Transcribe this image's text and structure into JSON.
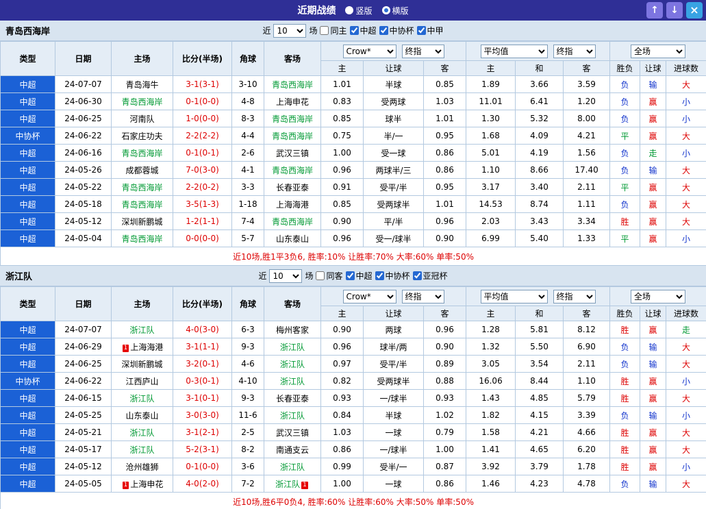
{
  "titlebar": {
    "title": "近期战绩",
    "radios": [
      {
        "label": "竖版",
        "selected": false
      },
      {
        "label": "横版",
        "selected": true
      }
    ],
    "up_button": "↑",
    "down_button": "↓",
    "close_button": "×"
  },
  "controls": {
    "bookmaker": "Crow*",
    "bookmaker_mode": "终指",
    "average": "平均值",
    "average_mode": "终指",
    "scope": "全场"
  },
  "header": {
    "main": [
      "类型",
      "日期",
      "主场",
      "比分(半场)",
      "角球",
      "客场"
    ],
    "sub": [
      "主",
      "让球",
      "客",
      "主",
      "和",
      "客",
      "胜负",
      "让球",
      "进球数"
    ]
  },
  "palette": {
    "red": "#dd0000",
    "blue": "#1133cc",
    "green": "#009933",
    "focal_team": "#009933",
    "league_cell_bg": "#1b61d6",
    "titlebar_bg": "#2f2f96"
  },
  "sections": [
    {
      "team": "青岛西海岸",
      "filter": {
        "prefix": "近",
        "count": "10",
        "suffix": "场",
        "same": {
          "label": "同主",
          "checked": false
        },
        "leagues": [
          {
            "label": "中超",
            "checked": true
          },
          {
            "label": "中协杯",
            "checked": true
          },
          {
            "label": "中甲",
            "checked": true
          }
        ]
      },
      "rows": [
        {
          "league": "中超",
          "date": "24-07-07",
          "home": {
            "name": "青岛海牛",
            "focal": false
          },
          "score": "3-1(3-1)",
          "corners": "3-10",
          "away": {
            "name": "青岛西海岸",
            "focal": true
          },
          "handicap": {
            "home": "1.01",
            "line": "半球",
            "away": "0.85"
          },
          "europe": {
            "home": "1.89",
            "draw": "3.66",
            "away": "3.59"
          },
          "results": [
            {
              "text": "负",
              "color": "blue"
            },
            {
              "text": "输",
              "color": "blue"
            },
            {
              "text": "大",
              "color": "red"
            }
          ]
        },
        {
          "league": "中超",
          "date": "24-06-30",
          "home": {
            "name": "青岛西海岸",
            "focal": true
          },
          "score": "0-1(0-0)",
          "corners": "4-8",
          "away": {
            "name": "上海申花",
            "focal": false
          },
          "handicap": {
            "home": "0.83",
            "line": "受两球",
            "away": "1.03"
          },
          "europe": {
            "home": "11.01",
            "draw": "6.41",
            "away": "1.20"
          },
          "results": [
            {
              "text": "负",
              "color": "blue"
            },
            {
              "text": "赢",
              "color": "red"
            },
            {
              "text": "小",
              "color": "blue"
            }
          ]
        },
        {
          "league": "中超",
          "date": "24-06-25",
          "home": {
            "name": "河南队",
            "focal": false
          },
          "score": "1-0(0-0)",
          "corners": "8-3",
          "away": {
            "name": "青岛西海岸",
            "focal": true
          },
          "handicap": {
            "home": "0.85",
            "line": "球半",
            "away": "1.01"
          },
          "europe": {
            "home": "1.30",
            "draw": "5.32",
            "away": "8.00"
          },
          "results": [
            {
              "text": "负",
              "color": "blue"
            },
            {
              "text": "赢",
              "color": "red"
            },
            {
              "text": "小",
              "color": "blue"
            }
          ]
        },
        {
          "league": "中协杯",
          "date": "24-06-22",
          "home": {
            "name": "石家庄功夫",
            "focal": false
          },
          "score": "2-2(2-2)",
          "corners": "4-4",
          "away": {
            "name": "青岛西海岸",
            "focal": true
          },
          "handicap": {
            "home": "0.75",
            "line": "半/一",
            "away": "0.95"
          },
          "europe": {
            "home": "1.68",
            "draw": "4.09",
            "away": "4.21"
          },
          "results": [
            {
              "text": "平",
              "color": "green"
            },
            {
              "text": "赢",
              "color": "red"
            },
            {
              "text": "大",
              "color": "red"
            }
          ]
        },
        {
          "league": "中超",
          "date": "24-06-16",
          "home": {
            "name": "青岛西海岸",
            "focal": true
          },
          "score": "0-1(0-1)",
          "corners": "2-6",
          "away": {
            "name": "武汉三镇",
            "focal": false
          },
          "handicap": {
            "home": "1.00",
            "line": "受一球",
            "away": "0.86"
          },
          "europe": {
            "home": "5.01",
            "draw": "4.19",
            "away": "1.56"
          },
          "results": [
            {
              "text": "负",
              "color": "blue"
            },
            {
              "text": "走",
              "color": "green"
            },
            {
              "text": "小",
              "color": "blue"
            }
          ]
        },
        {
          "league": "中超",
          "date": "24-05-26",
          "home": {
            "name": "成都蓉城",
            "focal": false
          },
          "score": "7-0(3-0)",
          "corners": "4-1",
          "away": {
            "name": "青岛西海岸",
            "focal": true
          },
          "handicap": {
            "home": "0.96",
            "line": "两球半/三",
            "away": "0.86"
          },
          "europe": {
            "home": "1.10",
            "draw": "8.66",
            "away": "17.40"
          },
          "results": [
            {
              "text": "负",
              "color": "blue"
            },
            {
              "text": "输",
              "color": "blue"
            },
            {
              "text": "大",
              "color": "red"
            }
          ]
        },
        {
          "league": "中超",
          "date": "24-05-22",
          "home": {
            "name": "青岛西海岸",
            "focal": true
          },
          "score": "2-2(0-2)",
          "corners": "3-3",
          "away": {
            "name": "长春亚泰",
            "focal": false
          },
          "handicap": {
            "home": "0.91",
            "line": "受平/半",
            "away": "0.95"
          },
          "europe": {
            "home": "3.17",
            "draw": "3.40",
            "away": "2.11"
          },
          "results": [
            {
              "text": "平",
              "color": "green"
            },
            {
              "text": "赢",
              "color": "red"
            },
            {
              "text": "大",
              "color": "red"
            }
          ]
        },
        {
          "league": "中超",
          "date": "24-05-18",
          "home": {
            "name": "青岛西海岸",
            "focal": true
          },
          "score": "3-5(1-3)",
          "corners": "1-18",
          "away": {
            "name": "上海海港",
            "focal": false
          },
          "handicap": {
            "home": "0.85",
            "line": "受两球半",
            "away": "1.01"
          },
          "europe": {
            "home": "14.53",
            "draw": "8.74",
            "away": "1.11"
          },
          "results": [
            {
              "text": "负",
              "color": "blue"
            },
            {
              "text": "赢",
              "color": "red"
            },
            {
              "text": "大",
              "color": "red"
            }
          ]
        },
        {
          "league": "中超",
          "date": "24-05-12",
          "home": {
            "name": "深圳新鹏城",
            "focal": false
          },
          "score": "1-2(1-1)",
          "corners": "7-4",
          "away": {
            "name": "青岛西海岸",
            "focal": true
          },
          "handicap": {
            "home": "0.90",
            "line": "平/半",
            "away": "0.96"
          },
          "europe": {
            "home": "2.03",
            "draw": "3.43",
            "away": "3.34"
          },
          "results": [
            {
              "text": "胜",
              "color": "red"
            },
            {
              "text": "赢",
              "color": "red"
            },
            {
              "text": "大",
              "color": "red"
            }
          ]
        },
        {
          "league": "中超",
          "date": "24-05-04",
          "home": {
            "name": "青岛西海岸",
            "focal": true
          },
          "score": "0-0(0-0)",
          "corners": "5-7",
          "away": {
            "name": "山东泰山",
            "focal": false
          },
          "handicap": {
            "home": "0.96",
            "line": "受一/球半",
            "away": "0.90"
          },
          "europe": {
            "home": "6.99",
            "draw": "5.40",
            "away": "1.33"
          },
          "results": [
            {
              "text": "平",
              "color": "green"
            },
            {
              "text": "赢",
              "color": "red"
            },
            {
              "text": "小",
              "color": "blue"
            }
          ]
        }
      ],
      "summary": "近10场,胜1平3负6, 胜率:10% 让胜率:70% 大率:60% 单率:50%"
    },
    {
      "team": "浙江队",
      "filter": {
        "prefix": "近",
        "count": "10",
        "suffix": "场",
        "same": {
          "label": "同客",
          "checked": false
        },
        "leagues": [
          {
            "label": "中超",
            "checked": true
          },
          {
            "label": "中协杯",
            "checked": true
          },
          {
            "label": "亚冠杯",
            "checked": true
          }
        ]
      },
      "rows": [
        {
          "league": "中超",
          "date": "24-07-07",
          "home": {
            "name": "浙江队",
            "focal": true
          },
          "score": "4-0(3-0)",
          "corners": "6-3",
          "away": {
            "name": "梅州客家",
            "focal": false
          },
          "handicap": {
            "home": "0.90",
            "line": "两球",
            "away": "0.96"
          },
          "europe": {
            "home": "1.28",
            "draw": "5.81",
            "away": "8.12"
          },
          "results": [
            {
              "text": "胜",
              "color": "red"
            },
            {
              "text": "赢",
              "color": "red"
            },
            {
              "text": "走",
              "color": "green"
            }
          ]
        },
        {
          "league": "中超",
          "date": "24-06-29",
          "home": {
            "name": "上海海港",
            "focal": false,
            "badge": "1"
          },
          "score": "3-1(1-1)",
          "corners": "9-3",
          "away": {
            "name": "浙江队",
            "focal": true
          },
          "handicap": {
            "home": "0.96",
            "line": "球半/两",
            "away": "0.90"
          },
          "europe": {
            "home": "1.32",
            "draw": "5.50",
            "away": "6.90"
          },
          "results": [
            {
              "text": "负",
              "color": "blue"
            },
            {
              "text": "输",
              "color": "blue"
            },
            {
              "text": "大",
              "color": "red"
            }
          ]
        },
        {
          "league": "中超",
          "date": "24-06-25",
          "home": {
            "name": "深圳新鹏城",
            "focal": false
          },
          "score": "3-2(0-1)",
          "corners": "4-6",
          "away": {
            "name": "浙江队",
            "focal": true
          },
          "handicap": {
            "home": "0.97",
            "line": "受平/半",
            "away": "0.89"
          },
          "europe": {
            "home": "3.05",
            "draw": "3.54",
            "away": "2.11"
          },
          "results": [
            {
              "text": "负",
              "color": "blue"
            },
            {
              "text": "输",
              "color": "blue"
            },
            {
              "text": "大",
              "color": "red"
            }
          ]
        },
        {
          "league": "中协杯",
          "date": "24-06-22",
          "home": {
            "name": "江西庐山",
            "focal": false
          },
          "score": "0-3(0-1)",
          "corners": "4-10",
          "away": {
            "name": "浙江队",
            "focal": true
          },
          "handicap": {
            "home": "0.82",
            "line": "受两球半",
            "away": "0.88"
          },
          "europe": {
            "home": "16.06",
            "draw": "8.44",
            "away": "1.10"
          },
          "results": [
            {
              "text": "胜",
              "color": "red"
            },
            {
              "text": "赢",
              "color": "red"
            },
            {
              "text": "小",
              "color": "blue"
            }
          ]
        },
        {
          "league": "中超",
          "date": "24-06-15",
          "home": {
            "name": "浙江队",
            "focal": true
          },
          "score": "3-1(0-1)",
          "corners": "9-3",
          "away": {
            "name": "长春亚泰",
            "focal": false
          },
          "handicap": {
            "home": "0.93",
            "line": "一/球半",
            "away": "0.93"
          },
          "europe": {
            "home": "1.43",
            "draw": "4.85",
            "away": "5.79"
          },
          "results": [
            {
              "text": "胜",
              "color": "red"
            },
            {
              "text": "赢",
              "color": "red"
            },
            {
              "text": "大",
              "color": "red"
            }
          ]
        },
        {
          "league": "中超",
          "date": "24-05-25",
          "home": {
            "name": "山东泰山",
            "focal": false
          },
          "score": "3-0(3-0)",
          "corners": "11-6",
          "away": {
            "name": "浙江队",
            "focal": true
          },
          "handicap": {
            "home": "0.84",
            "line": "半球",
            "away": "1.02"
          },
          "europe": {
            "home": "1.82",
            "draw": "4.15",
            "away": "3.39"
          },
          "results": [
            {
              "text": "负",
              "color": "blue"
            },
            {
              "text": "输",
              "color": "blue"
            },
            {
              "text": "小",
              "color": "blue"
            }
          ]
        },
        {
          "league": "中超",
          "date": "24-05-21",
          "home": {
            "name": "浙江队",
            "focal": true
          },
          "score": "3-1(2-1)",
          "corners": "2-5",
          "away": {
            "name": "武汉三镇",
            "focal": false
          },
          "handicap": {
            "home": "1.03",
            "line": "一球",
            "away": "0.79"
          },
          "europe": {
            "home": "1.58",
            "draw": "4.21",
            "away": "4.66"
          },
          "results": [
            {
              "text": "胜",
              "color": "red"
            },
            {
              "text": "赢",
              "color": "red"
            },
            {
              "text": "大",
              "color": "red"
            }
          ]
        },
        {
          "league": "中超",
          "date": "24-05-17",
          "home": {
            "name": "浙江队",
            "focal": true
          },
          "score": "5-2(3-1)",
          "corners": "8-2",
          "away": {
            "name": "南通支云",
            "focal": false
          },
          "handicap": {
            "home": "0.86",
            "line": "一/球半",
            "away": "1.00"
          },
          "europe": {
            "home": "1.41",
            "draw": "4.65",
            "away": "6.20"
          },
          "results": [
            {
              "text": "胜",
              "color": "red"
            },
            {
              "text": "赢",
              "color": "red"
            },
            {
              "text": "大",
              "color": "red"
            }
          ]
        },
        {
          "league": "中超",
          "date": "24-05-12",
          "home": {
            "name": "沧州雄狮",
            "focal": false
          },
          "score": "0-1(0-0)",
          "corners": "3-6",
          "away": {
            "name": "浙江队",
            "focal": true
          },
          "handicap": {
            "home": "0.99",
            "line": "受半/一",
            "away": "0.87"
          },
          "europe": {
            "home": "3.92",
            "draw": "3.79",
            "away": "1.78"
          },
          "results": [
            {
              "text": "胜",
              "color": "red"
            },
            {
              "text": "赢",
              "color": "red"
            },
            {
              "text": "小",
              "color": "blue"
            }
          ]
        },
        {
          "league": "中超",
          "date": "24-05-05",
          "home": {
            "name": "上海申花",
            "focal": false,
            "badge": "1"
          },
          "score": "4-0(2-0)",
          "corners": "7-2",
          "away": {
            "name": "浙江队",
            "focal": true,
            "badge": "1",
            "badgeAfter": true
          },
          "handicap": {
            "home": "1.00",
            "line": "一球",
            "away": "0.86"
          },
          "europe": {
            "home": "1.46",
            "draw": "4.23",
            "away": "4.78"
          },
          "results": [
            {
              "text": "负",
              "color": "blue"
            },
            {
              "text": "输",
              "color": "blue"
            },
            {
              "text": "大",
              "color": "red"
            }
          ]
        }
      ],
      "summary": "近10场,胜6平0负4, 胜率:60% 让胜率:60% 大率:50% 单率:50%"
    }
  ]
}
